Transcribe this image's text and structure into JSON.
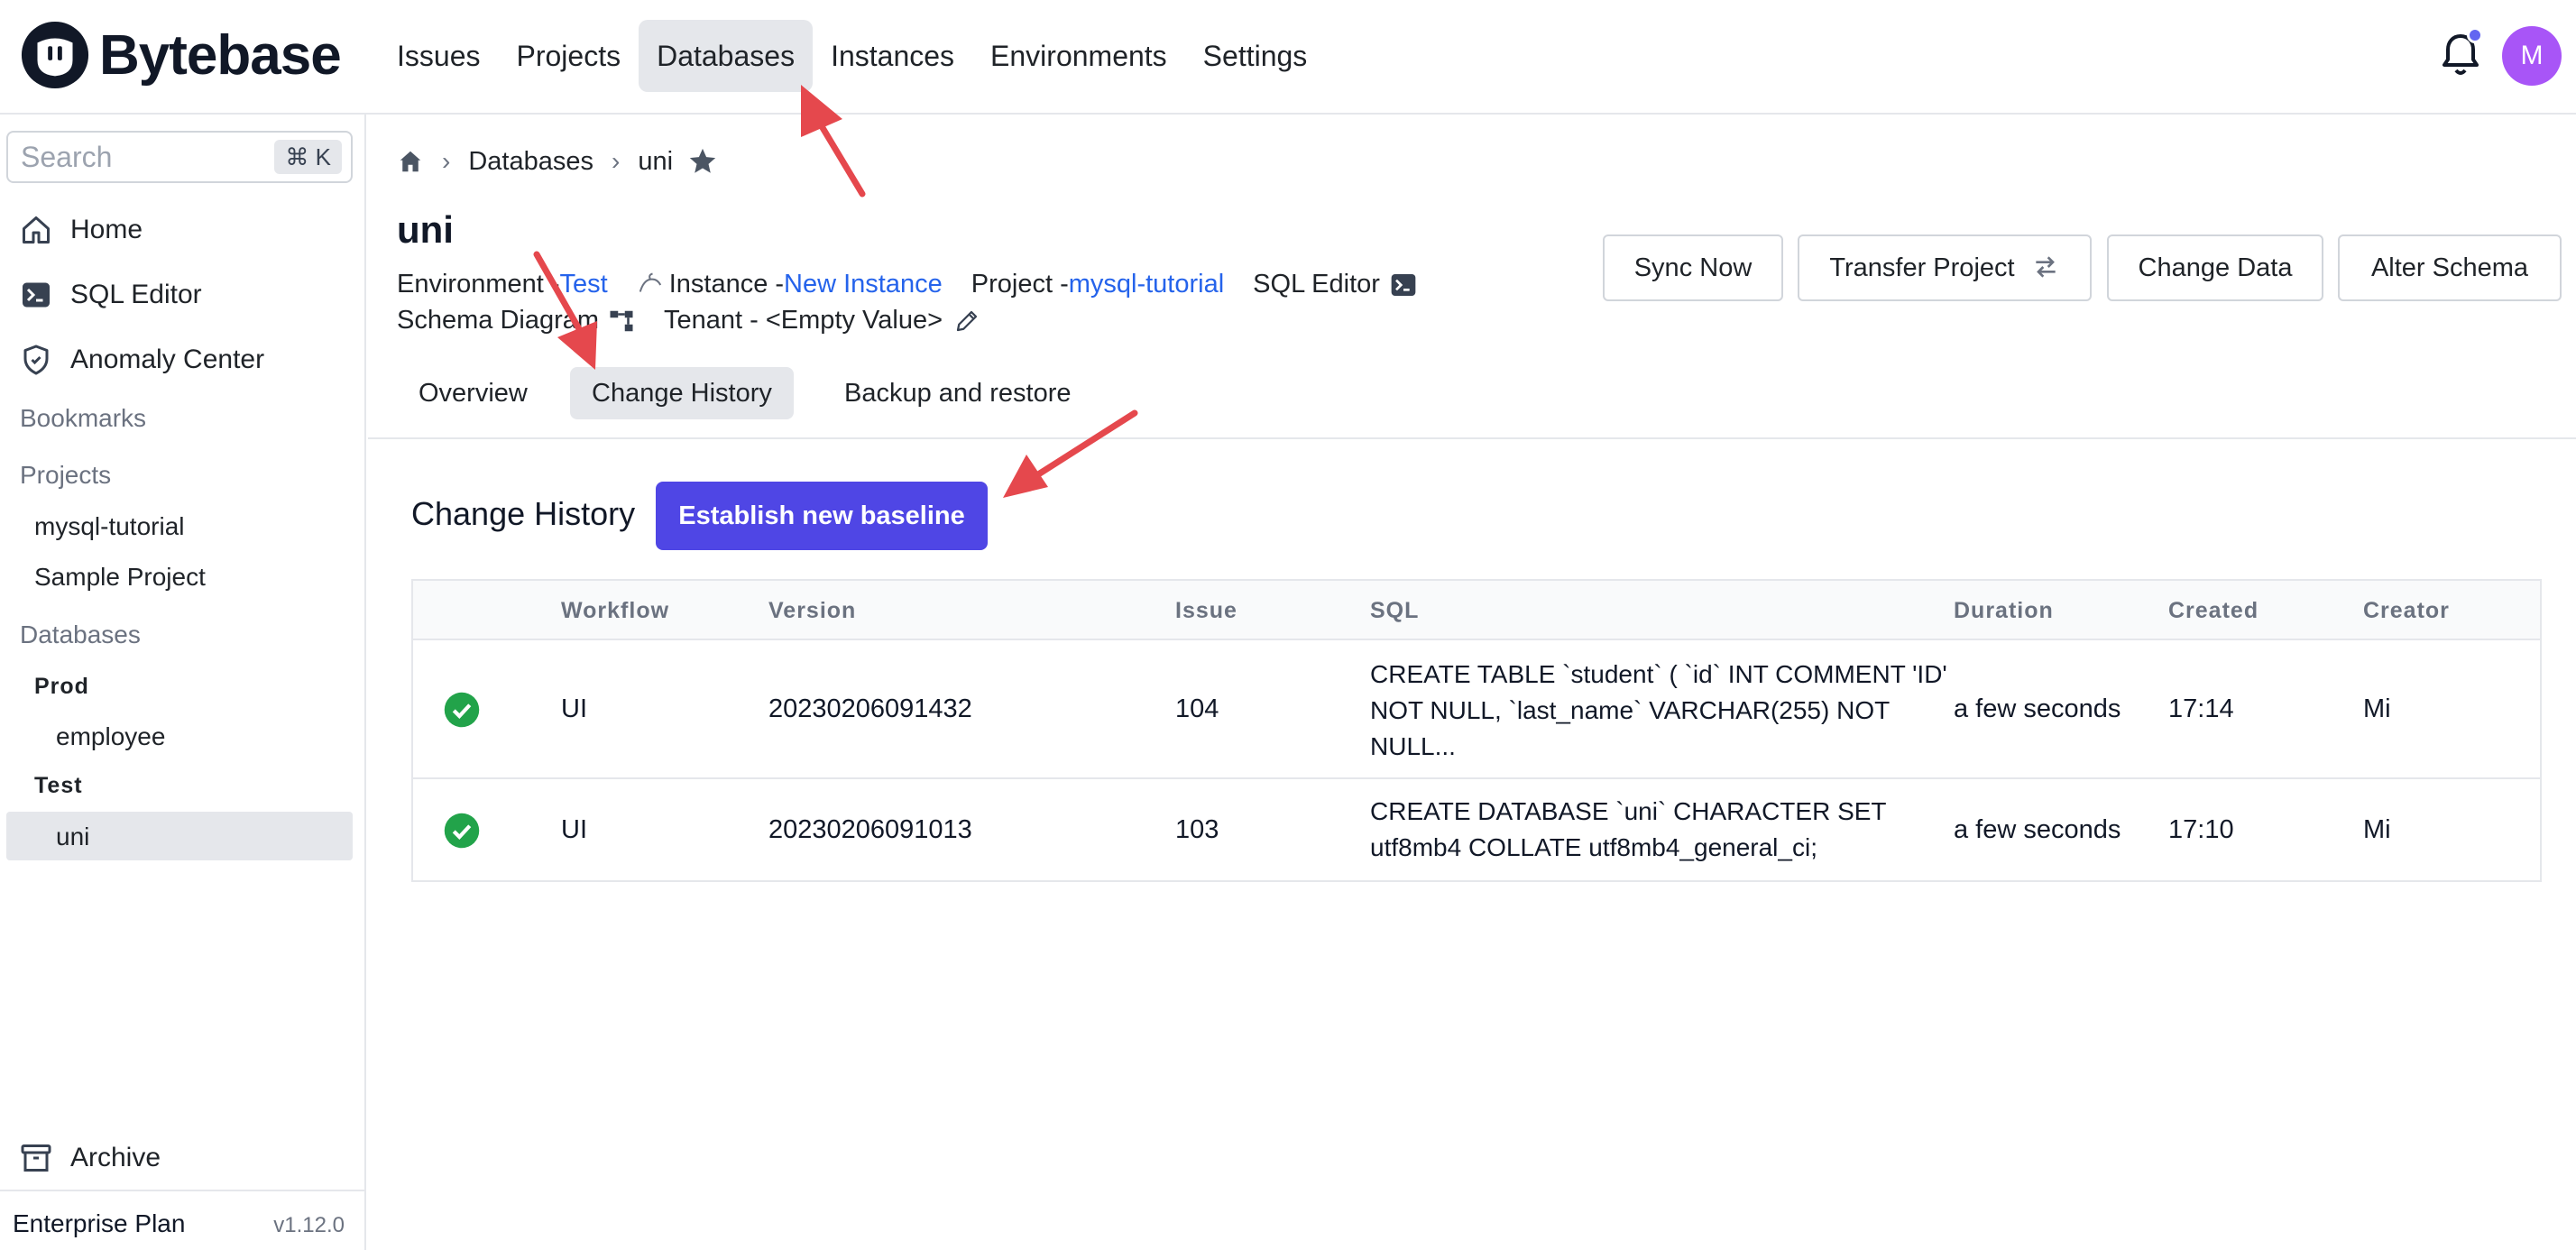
{
  "app": {
    "brand": "Bytebase",
    "accent": "#4f46e5",
    "link_color": "#2563eb"
  },
  "topnav": {
    "items": [
      "Issues",
      "Projects",
      "Databases",
      "Instances",
      "Environments",
      "Settings"
    ],
    "active": "Databases",
    "avatar_initial": "M"
  },
  "sidebar": {
    "search_placeholder": "Search",
    "search_shortcut": "⌘ K",
    "home": "Home",
    "sql_editor": "SQL Editor",
    "anomaly_center": "Anomaly Center",
    "bookmarks": "Bookmarks",
    "projects_head": "Projects",
    "projects": [
      "mysql-tutorial",
      "Sample Project"
    ],
    "databases_head": "Databases",
    "env_prod": "Prod",
    "db_employee": "employee",
    "env_test": "Test",
    "db_uni": "uni",
    "archive": "Archive",
    "plan": "Enterprise Plan",
    "version": "v1.12.0"
  },
  "breadcrumb": {
    "databases": "Databases",
    "current": "uni"
  },
  "database": {
    "name": "uni",
    "environment_label": "Environment - ",
    "environment": "Test",
    "instance_label": "Instance - ",
    "instance": "New Instance",
    "project_label": "Project - ",
    "project": "mysql-tutorial",
    "sql_editor": "SQL Editor",
    "schema_diagram": "Schema Diagram",
    "tenant": "Tenant - <Empty Value>"
  },
  "actions": {
    "sync": "Sync Now",
    "transfer": "Transfer Project",
    "change_data": "Change Data",
    "alter_schema": "Alter Schema"
  },
  "tabs": {
    "overview": "Overview",
    "change_history": "Change History",
    "backup": "Backup and restore",
    "active": "Change History"
  },
  "history": {
    "title": "Change History",
    "baseline_button": "Establish new baseline",
    "columns": {
      "workflow": "Workflow",
      "version": "Version",
      "issue": "Issue",
      "sql": "SQL",
      "duration": "Duration",
      "created": "Created",
      "creator": "Creator"
    },
    "rows": [
      {
        "status": "success",
        "workflow": "UI",
        "version": "20230206091432",
        "issue": "104",
        "sql": "CREATE TABLE `student` ( `id` INT COMMENT 'ID' NOT NULL, `last_name` VARCHAR(255) NOT NULL...",
        "duration": "a few seconds",
        "created": "17:14",
        "creator": "Mi"
      },
      {
        "status": "success",
        "workflow": "UI",
        "version": "20230206091013",
        "issue": "103",
        "sql": "CREATE DATABASE `uni` CHARACTER SET utf8mb4 COLLATE utf8mb4_general_ci;",
        "duration": "a few seconds",
        "created": "17:10",
        "creator": "Mi"
      }
    ]
  }
}
